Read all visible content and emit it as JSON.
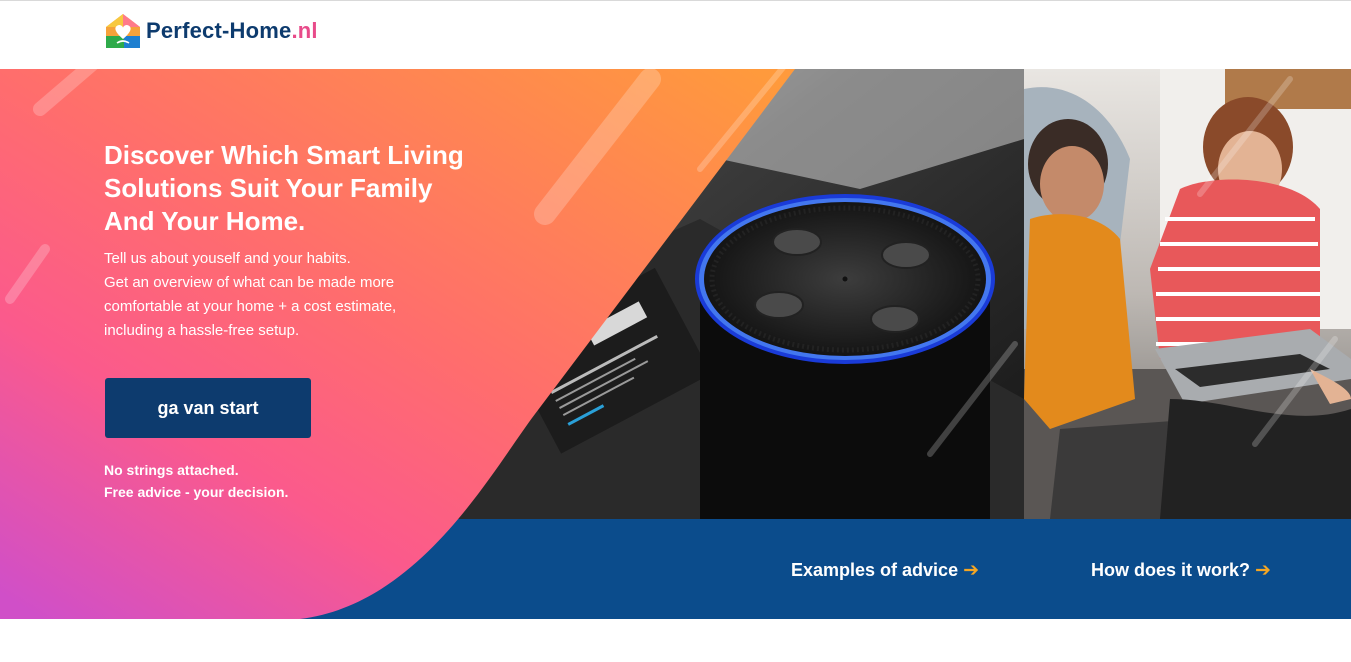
{
  "brand": {
    "name": "Perfect-Home",
    "tld": ".nl"
  },
  "hero": {
    "title": "Discover Which Smart Living Solutions Suit Your Family And Your Home.",
    "body": [
      "Tell us about youself and your habits.",
      "Get an overview of what can be made more comfortable at your home + a cost estimate, including a hassle-free setup."
    ],
    "cta_label": "ga van start",
    "note": [
      "No strings attached.",
      "Free advice - your decision."
    ]
  },
  "nav": {
    "examples_label": "Examples of advice",
    "how_label": "How does it work?",
    "arrow": "➔"
  },
  "colors": {
    "navy": "#0d3b6e",
    "band_blue": "#0b4c8c",
    "gradient_orange": "#ff9a3c",
    "gradient_pink": "#ff5f7e",
    "gradient_magenta": "#d04fc8",
    "accent_yellow": "#f5a623",
    "tld_pink": "#e84b8a"
  },
  "icons": {
    "logo": "house-heart-logo-icon",
    "arrow": "arrow-right-icon",
    "smart_speaker": "smart-speaker-photo",
    "couple_laptop": "couple-with-laptop-photo"
  }
}
